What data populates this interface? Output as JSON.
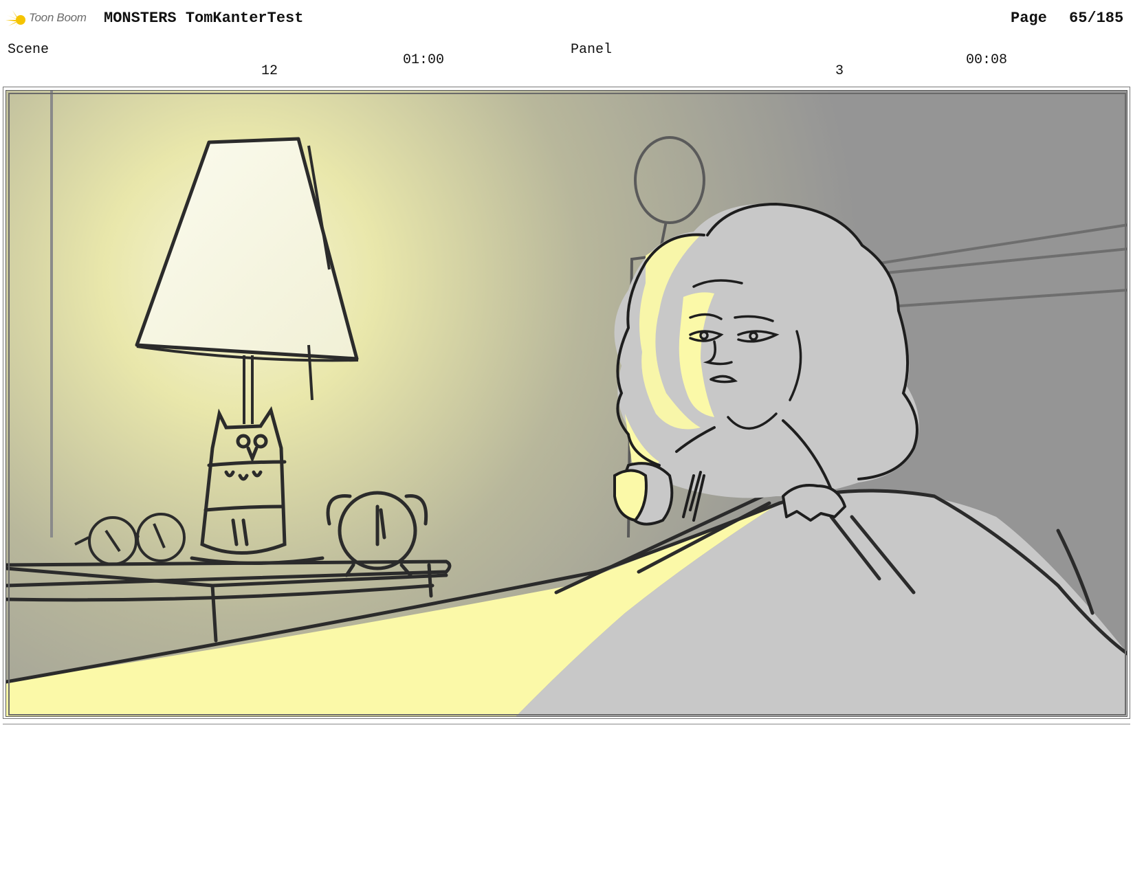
{
  "header": {
    "logo_text": "Toon Boom",
    "title": "MONSTERS TomKanterTest",
    "page_label": "Page",
    "page_number": "65/185"
  },
  "scene": {
    "label": "Scene",
    "number": "12",
    "duration": "01:00"
  },
  "panel": {
    "label": "Panel",
    "number": "3",
    "duration": "00:08"
  },
  "colors": {
    "lamp_glow": "#f3f2c8",
    "light_beam": "#fbf9a8",
    "background_gray": "#979797",
    "figure_gray": "#c8c8c8",
    "logo_accent": "#f5c400"
  }
}
